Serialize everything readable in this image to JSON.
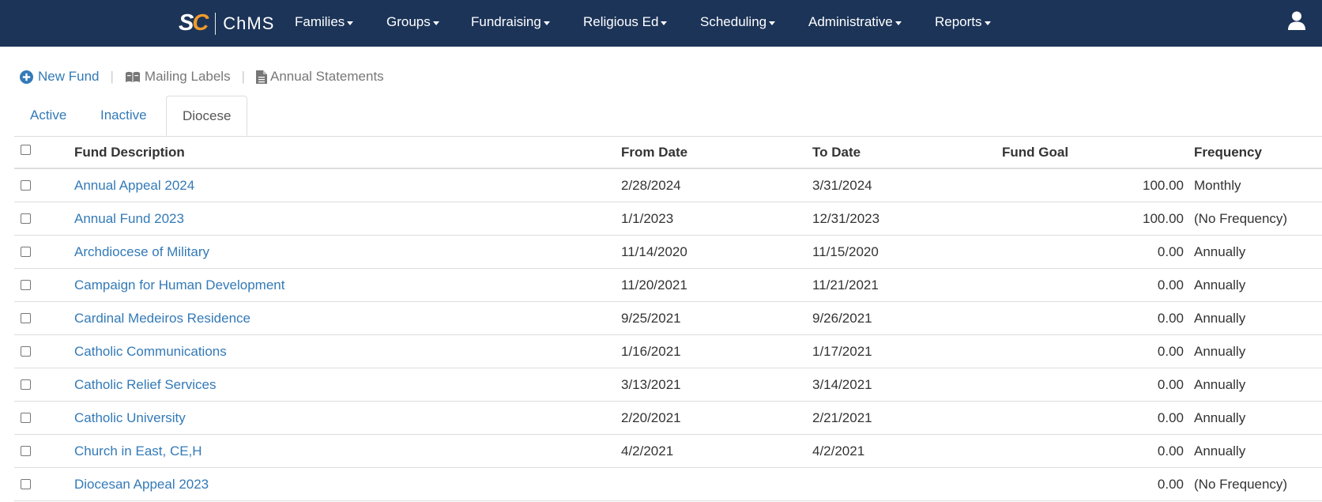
{
  "navbar": {
    "brand_sc_1": "S",
    "brand_sc_2": "C",
    "brand_chms": "ChMS",
    "items": [
      {
        "label": "Families"
      },
      {
        "label": "Groups"
      },
      {
        "label": "Fundraising"
      },
      {
        "label": "Religious Ed"
      },
      {
        "label": "Scheduling"
      },
      {
        "label": "Administrative"
      },
      {
        "label": "Reports"
      }
    ],
    "user_icon": "user-icon"
  },
  "toolbar": {
    "new_fund": "New Fund",
    "mailing_labels": "Mailing Labels",
    "annual_statements": "Annual Statements",
    "separator": "|"
  },
  "tabs": [
    {
      "label": "Active",
      "active": false
    },
    {
      "label": "Inactive",
      "active": false
    },
    {
      "label": "Diocese",
      "active": true
    }
  ],
  "table": {
    "headers": {
      "description": "Fund Description",
      "from_date": "From Date",
      "to_date": "To Date",
      "fund_goal": "Fund Goal",
      "frequency": "Frequency"
    },
    "rows": [
      {
        "description": "Annual Appeal 2024",
        "from": "2/28/2024",
        "to": "3/31/2024",
        "goal": "100.00",
        "frequency": "Monthly"
      },
      {
        "description": "Annual Fund 2023",
        "from": "1/1/2023",
        "to": "12/31/2023",
        "goal": "100.00",
        "frequency": "(No Frequency)"
      },
      {
        "description": "Archdiocese of Military",
        "from": "11/14/2020",
        "to": "11/15/2020",
        "goal": "0.00",
        "frequency": "Annually"
      },
      {
        "description": "Campaign for Human Development",
        "from": "11/20/2021",
        "to": "11/21/2021",
        "goal": "0.00",
        "frequency": "Annually"
      },
      {
        "description": "Cardinal Medeiros Residence",
        "from": "9/25/2021",
        "to": "9/26/2021",
        "goal": "0.00",
        "frequency": "Annually"
      },
      {
        "description": "Catholic Communications",
        "from": "1/16/2021",
        "to": "1/17/2021",
        "goal": "0.00",
        "frequency": "Annually"
      },
      {
        "description": "Catholic Relief Services",
        "from": "3/13/2021",
        "to": "3/14/2021",
        "goal": "0.00",
        "frequency": "Annually"
      },
      {
        "description": "Catholic University",
        "from": "2/20/2021",
        "to": "2/21/2021",
        "goal": "0.00",
        "frequency": "Annually"
      },
      {
        "description": "Church in East, CE,H",
        "from": "4/2/2021",
        "to": "4/2/2021",
        "goal": "0.00",
        "frequency": "Annually"
      },
      {
        "description": "Diocesan Appeal 2023",
        "from": "",
        "to": "",
        "goal": "0.00",
        "frequency": "(No Frequency)"
      }
    ]
  },
  "colors": {
    "navbar_bg": "#1c3458",
    "brand_accent": "#f19a2b",
    "link": "#337ab7",
    "muted": "#777777"
  }
}
